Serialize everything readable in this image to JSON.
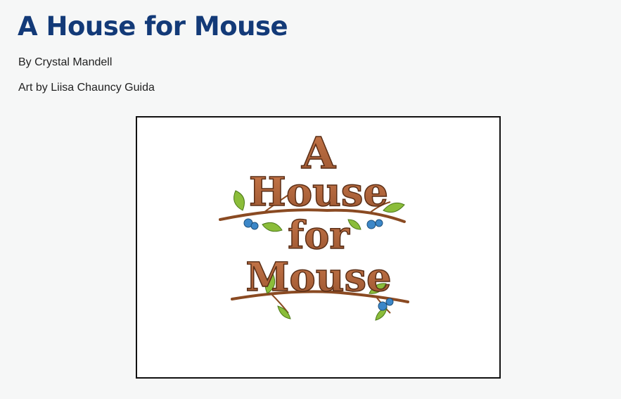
{
  "story": {
    "title": "A House for Mouse",
    "author_line": "By Crystal Mandell",
    "artist_line": "Art by Liisa Chauncy Guida"
  },
  "illustration": {
    "logo_text_lines": [
      "A",
      "House",
      "for",
      "Mouse"
    ]
  },
  "colors": {
    "title": "#133a78",
    "wood": "#b0653a",
    "wood_dark": "#5a2e16",
    "leaf": "#8bbd3a",
    "berry": "#3c87c8"
  }
}
